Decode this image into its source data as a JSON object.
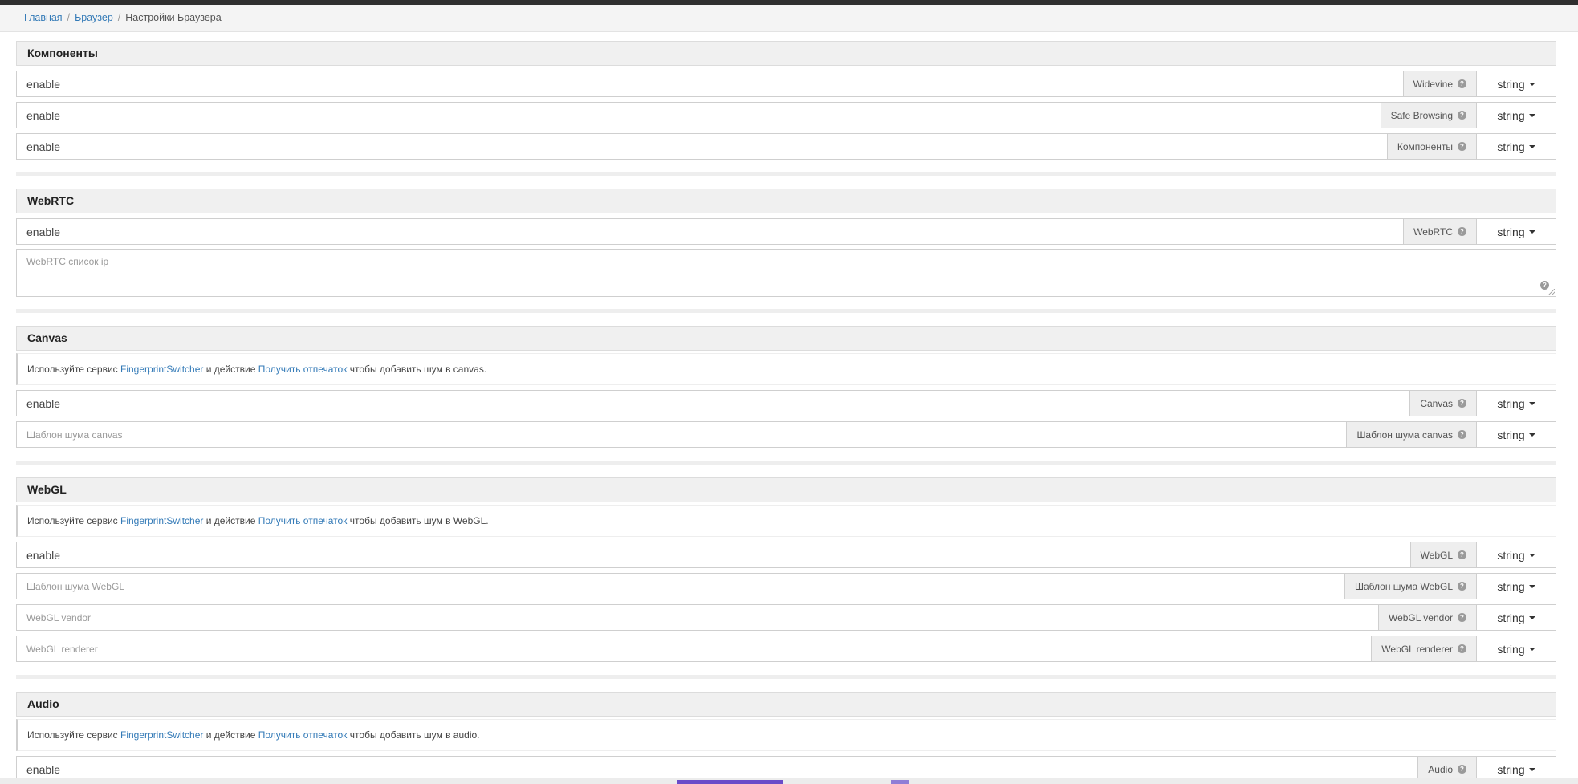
{
  "breadcrumb": {
    "items": [
      "Главная",
      "Браузер"
    ],
    "current": "Настройки Браузера"
  },
  "note": {
    "prefix": "Используйте сервис",
    "service": "FingerprintSwitcher",
    "mid": "и действие",
    "action": "Получить отпечаток",
    "suffix_canvas": "чтобы добавить шум в canvas.",
    "suffix_webgl": "чтобы добавить шум в WebGL.",
    "suffix_audio": "чтобы добавить шум в audio."
  },
  "type_label": "string",
  "sections": {
    "components": {
      "title": "Компоненты",
      "rows": [
        {
          "value": "enable",
          "label": "Widevine"
        },
        {
          "value": "enable",
          "label": "Safe Browsing"
        },
        {
          "value": "enable",
          "label": "Компоненты"
        }
      ]
    },
    "webrtc": {
      "title": "WebRTC",
      "row": {
        "value": "enable",
        "label": "WebRTC"
      },
      "textarea_placeholder": "WebRTC список ip"
    },
    "canvas": {
      "title": "Canvas",
      "rows": [
        {
          "value": "enable",
          "label": "Canvas"
        },
        {
          "placeholder": "Шаблон шума canvas",
          "label": "Шаблон шума canvas"
        }
      ]
    },
    "webgl": {
      "title": "WebGL",
      "rows": [
        {
          "value": "enable",
          "label": "WebGL"
        },
        {
          "placeholder": "Шаблон шума WebGL",
          "label": "Шаблон шума WebGL"
        },
        {
          "placeholder": "WebGL vendor",
          "label": "WebGL vendor"
        },
        {
          "placeholder": "WebGL renderer",
          "label": "WebGL renderer"
        }
      ]
    },
    "audio": {
      "title": "Audio",
      "row": {
        "value": "enable",
        "label": "Audio"
      }
    }
  }
}
